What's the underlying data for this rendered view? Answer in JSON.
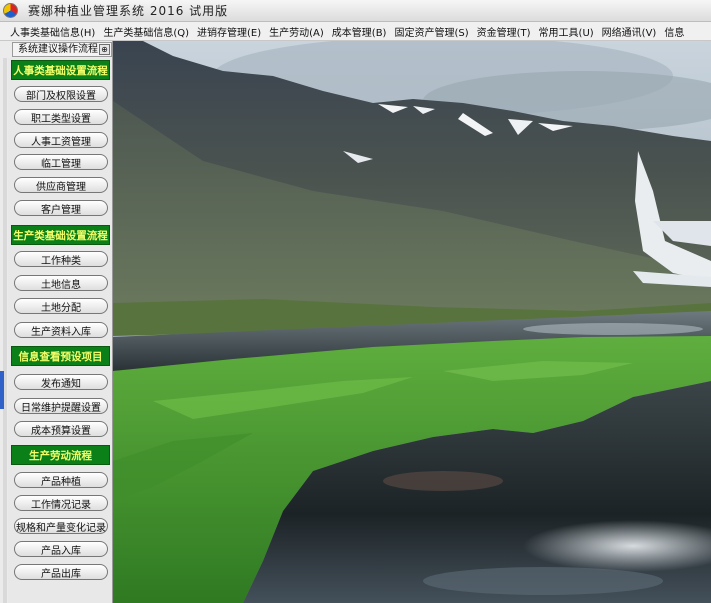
{
  "app": {
    "title": "赛娜种植业管理系统   2016   试用版",
    "icon": "app-logo-icon"
  },
  "menu": [
    "人事类基础信息(H)",
    "生产类基础信息(Q)",
    "进销存管理(E)",
    "生产劳动(A)",
    "成本管理(B)",
    "固定资产管理(S)",
    "资金管理(T)",
    "常用工具(U)",
    "网络通讯(V)",
    "信息"
  ],
  "sidebar": {
    "tab_label": "系统建议操作流程",
    "pin_icon": "pin-icon",
    "sections": [
      {
        "title": "人事类基础设置流程",
        "items": [
          "部门及权限设置",
          "职工类型设置",
          "人事工资管理",
          "临工管理",
          "供应商管理",
          "客户管理"
        ]
      },
      {
        "title": "生产类基础设置流程",
        "items": [
          "工作种类",
          "土地信息",
          "土地分配",
          "生产资料入库"
        ]
      },
      {
        "title": "信息查看预设项目",
        "items": [
          "发布通知",
          "日常维护提醒设置",
          "成本预算设置"
        ]
      },
      {
        "title": "生产劳动流程",
        "items": [
          "产品种植",
          "工作情况记录",
          "规格和产量变化记录",
          "产品入库",
          "产品出库"
        ]
      }
    ]
  },
  "colors": {
    "section_bg": "#0b7f18",
    "section_text": "#f4ff6a",
    "accent_blue": "#2f61c8"
  }
}
